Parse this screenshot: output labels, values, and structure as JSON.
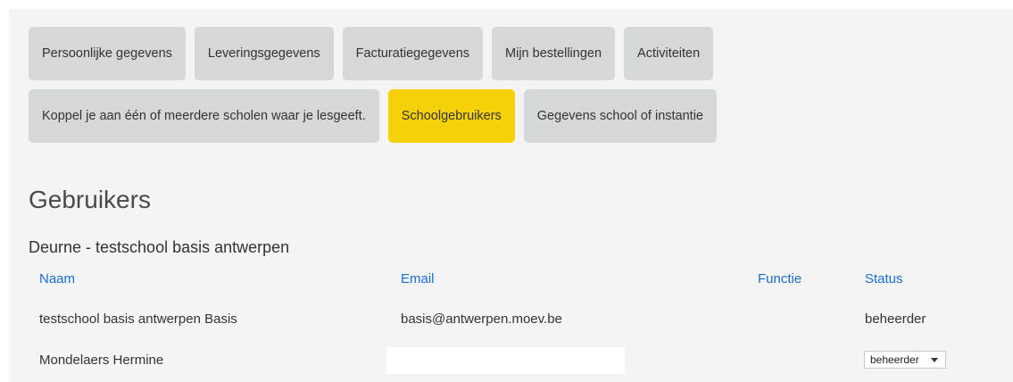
{
  "tabs_row1": [
    {
      "label": "Persoonlijke gegevens",
      "active": false
    },
    {
      "label": "Leveringsgegevens",
      "active": false
    },
    {
      "label": "Facturatiegegevens",
      "active": false
    },
    {
      "label": "Mijn bestellingen",
      "active": false
    },
    {
      "label": "Activiteiten",
      "active": false
    }
  ],
  "tabs_row2": [
    {
      "label": "Koppel je aan één of meerdere scholen waar je lesgeeft.",
      "active": false
    },
    {
      "label": "Schoolgebruikers",
      "active": true
    },
    {
      "label": "Gegevens school of instantie",
      "active": false
    }
  ],
  "page_title": "Gebruikers",
  "school": "Deurne - testschool basis antwerpen",
  "table": {
    "headers": {
      "naam": "Naam",
      "email": "Email",
      "functie": "Functie",
      "status": "Status"
    },
    "rows": [
      {
        "naam": "testschool basis antwerpen Basis",
        "email": "basis@antwerpen.moev.be",
        "functie": "",
        "status": "beheerder"
      },
      {
        "naam": "Mondelaers Hermine",
        "email": "",
        "functie": "",
        "status_select": "beheerder"
      }
    ]
  },
  "colors": {
    "accent": "#f7d108",
    "tab_bg": "#d4d8d9",
    "header_link": "#1a6ecf",
    "panel_bg": "#f4f4f4"
  }
}
